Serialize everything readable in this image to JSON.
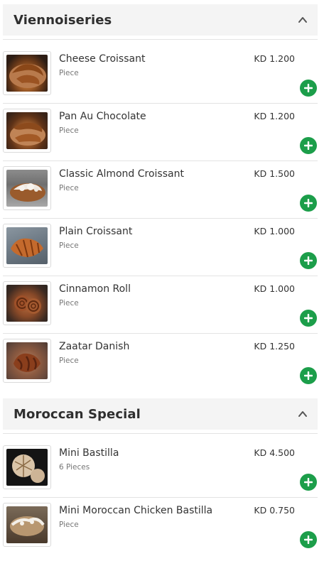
{
  "sections": [
    {
      "title": "Viennoiseries",
      "items": [
        {
          "name": "Cheese Croissant",
          "unit": "Piece",
          "price": "KD 1.200"
        },
        {
          "name": "Pan Au Chocolate",
          "unit": "Piece",
          "price": "KD 1.200"
        },
        {
          "name": "Classic Almond Croissant",
          "unit": "Piece",
          "price": "KD 1.500"
        },
        {
          "name": "Plain Croissant",
          "unit": "Piece",
          "price": "KD 1.000"
        },
        {
          "name": "Cinnamon Roll",
          "unit": "Piece",
          "price": "KD 1.000"
        },
        {
          "name": "Zaatar Danish",
          "unit": "Piece",
          "price": "KD 1.250"
        }
      ]
    },
    {
      "title": "Moroccan Special",
      "items": [
        {
          "name": "Mini Bastilla",
          "unit": "6 Pieces",
          "price": "KD 4.500"
        },
        {
          "name": "Mini Moroccan Chicken Bastilla",
          "unit": "Piece",
          "price": "KD 0.750"
        }
      ]
    }
  ],
  "icons": {
    "collapse": "chevron-up-icon",
    "add": "plus-icon"
  },
  "colors": {
    "accent": "#1c9e4a",
    "header_bg": "#f4f4f4"
  }
}
